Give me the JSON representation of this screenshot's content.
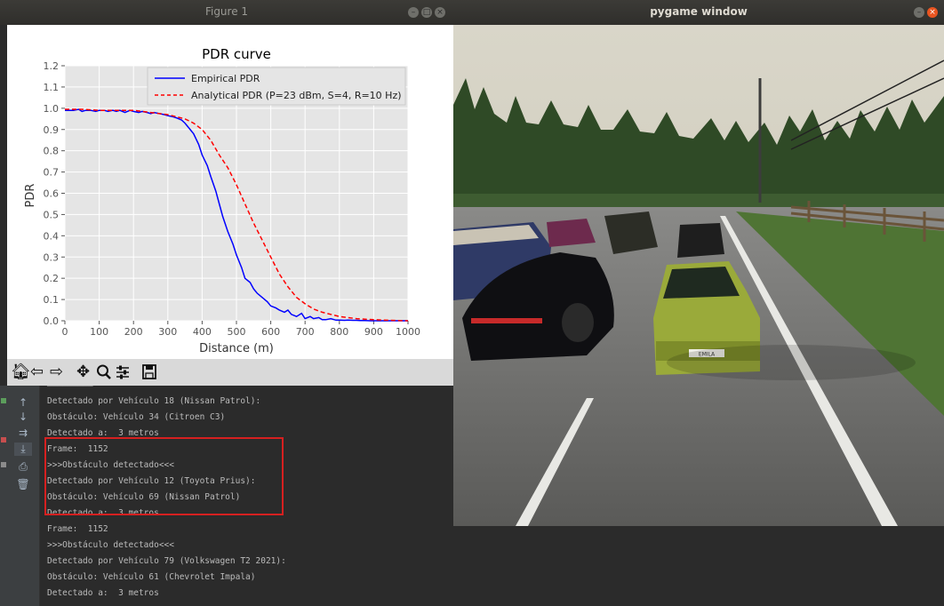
{
  "figure_window": {
    "title": "Figure 1",
    "toolbar_icons": [
      "home-icon",
      "back-arrow-icon",
      "forward-arrow-icon",
      "pan-icon",
      "zoom-icon",
      "configure-subplots-icon",
      "save-icon"
    ]
  },
  "pygame_window": {
    "title": "pygame window",
    "license_plate": "EMILA"
  },
  "chart_data": {
    "type": "line",
    "title": "PDR curve",
    "xlabel": "Distance (m)",
    "ylabel": "PDR",
    "xlim": [
      0,
      1000
    ],
    "ylim": [
      0,
      1.2
    ],
    "xticks": [
      "0",
      "100",
      "200",
      "300",
      "400",
      "500",
      "600",
      "700",
      "800",
      "900",
      "1000"
    ],
    "yticks": [
      "0.0",
      "0.1",
      "0.2",
      "0.3",
      "0.4",
      "0.5",
      "0.6",
      "0.7",
      "0.8",
      "0.9",
      "1.0",
      "1.1",
      "1.2"
    ],
    "grid": true,
    "legend_position": "top-right",
    "series": [
      {
        "name": "Empirical PDR",
        "color": "#0000ff",
        "style": "solid",
        "x": [
          0,
          25,
          40,
          50,
          60,
          75,
          90,
          100,
          115,
          125,
          140,
          150,
          160,
          175,
          190,
          200,
          215,
          225,
          240,
          250,
          260,
          275,
          290,
          300,
          315,
          325,
          340,
          350,
          360,
          375,
          390,
          400,
          415,
          425,
          440,
          450,
          460,
          475,
          490,
          500,
          515,
          525,
          540,
          550,
          560,
          575,
          590,
          600,
          615,
          625,
          640,
          650,
          660,
          675,
          690,
          700,
          715,
          725,
          740,
          750,
          760,
          775,
          790,
          800,
          815,
          825,
          840,
          850,
          860,
          875,
          890,
          900,
          925,
          950,
          975,
          1000
        ],
        "y": [
          0.99,
          0.99,
          0.995,
          0.985,
          0.99,
          0.99,
          0.985,
          0.99,
          0.99,
          0.985,
          0.99,
          0.985,
          0.99,
          0.98,
          0.99,
          0.985,
          0.98,
          0.985,
          0.98,
          0.975,
          0.98,
          0.975,
          0.97,
          0.965,
          0.96,
          0.955,
          0.945,
          0.93,
          0.91,
          0.88,
          0.83,
          0.78,
          0.73,
          0.68,
          0.61,
          0.55,
          0.49,
          0.42,
          0.36,
          0.31,
          0.25,
          0.2,
          0.18,
          0.15,
          0.13,
          0.11,
          0.09,
          0.07,
          0.06,
          0.05,
          0.04,
          0.05,
          0.03,
          0.02,
          0.035,
          0.01,
          0.02,
          0.01,
          0.015,
          0.005,
          0.005,
          0.01,
          0.003,
          0.003,
          0.002,
          0.003,
          0.002,
          0.002,
          0.001,
          0.001,
          0,
          0,
          0,
          0,
          0,
          0
        ]
      },
      {
        "name": "Analytical PDR (P=23 dBm, S=4, R=10 Hz)",
        "color": "#ff0000",
        "style": "dashed",
        "x": [
          0,
          50,
          100,
          150,
          200,
          250,
          300,
          350,
          375,
          400,
          425,
          450,
          475,
          500,
          525,
          550,
          575,
          600,
          625,
          650,
          675,
          700,
          725,
          750,
          775,
          800,
          850,
          900,
          950,
          1000
        ],
        "y": [
          0.995,
          0.995,
          0.99,
          0.99,
          0.99,
          0.98,
          0.97,
          0.95,
          0.93,
          0.9,
          0.85,
          0.78,
          0.72,
          0.64,
          0.55,
          0.46,
          0.38,
          0.3,
          0.22,
          0.16,
          0.11,
          0.08,
          0.055,
          0.04,
          0.03,
          0.02,
          0.01,
          0.005,
          0.002,
          0
        ]
      }
    ]
  },
  "console": {
    "lines": [
      {
        "text": "Detectado por Vehículo 18 (Nissan Patrol):"
      },
      {
        "text": "Obstáculo: Vehículo 34 (Citroen C3)"
      },
      {
        "text": "Detectado a:  3 metros"
      },
      {
        "text": "Frame:  1152"
      },
      {
        "text": ">>>Obstáculo detectado<<<"
      },
      {
        "text": "Detectado por Vehículo 12 (Toyota Prius):"
      },
      {
        "text": "Obstáculo: Vehículo 69 (Nissan Patrol)"
      },
      {
        "text": "Detectado a:  3 metros"
      },
      {
        "text": "Frame:  1152"
      },
      {
        "text": ">>>Obstáculo detectado<<<"
      },
      {
        "text": "Detectado por Vehículo 79 (Volkswagen T2 2021):"
      },
      {
        "text": "Obstáculo: Vehículo 61 (Chevrolet Impala)"
      },
      {
        "text": "Detectado a:  3 metros"
      }
    ],
    "gutter_icons": [
      "scroll-up-arrow-icon",
      "scroll-down-arrow-icon",
      "soft-wrap-icon",
      "scroll-to-end-icon",
      "print-icon",
      "trash-icon"
    ]
  }
}
